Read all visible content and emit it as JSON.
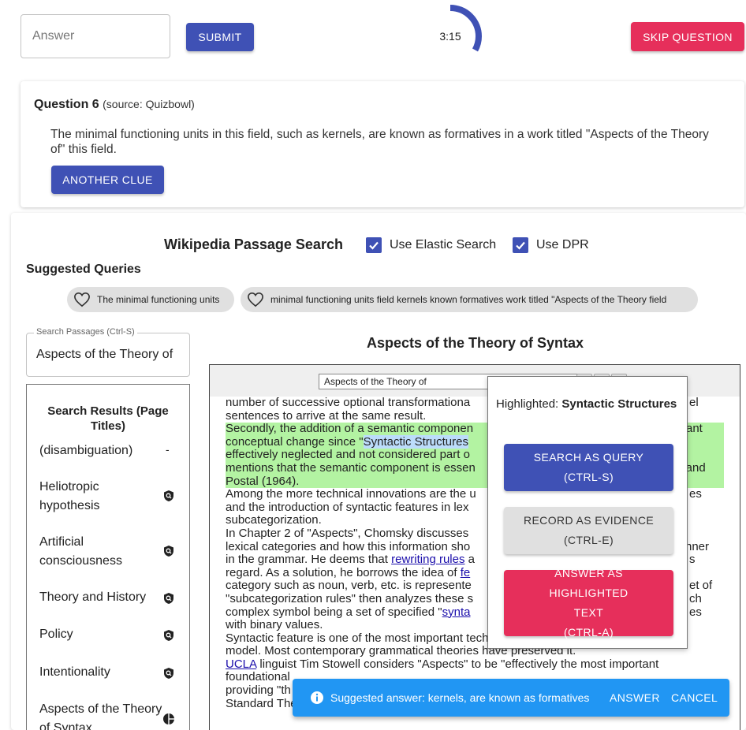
{
  "top_bar": {
    "answer_placeholder": "Answer",
    "submit_label": "SUBMIT",
    "timer_text": "3:15",
    "timer_progress": 0.33,
    "skip_label": "SKIP QUESTION"
  },
  "question": {
    "title": "Question 6",
    "source": "(source: Quizbowl)",
    "text": "The minimal functioning units in this field, such as kernels, are known as formatives in a work titled \"Aspects of the Theory of\" this field.",
    "another_clue_label": "ANOTHER CLUE"
  },
  "wiki_search": {
    "title": "Wikipedia Passage Search",
    "use_elastic_label": "Use Elastic Search",
    "use_elastic_checked": true,
    "use_dpr_label": "Use DPR",
    "use_dpr_checked": true
  },
  "suggested_queries": {
    "title": "Suggested Queries",
    "chips": [
      "The minimal functioning units",
      "minimal functioning units field kernels known formatives work titled \"Aspects of the Theory field"
    ]
  },
  "search_passages": {
    "label": "Search Passages (Ctrl-S)",
    "value": "Aspects of the Theory of"
  },
  "search_results": {
    "title": "Search Results (Page Titles)",
    "items": [
      {
        "label": "(disambiguation)",
        "icon": "dash-icon"
      },
      {
        "label": "Heliotropic hypothesis",
        "icon": "shield-search-icon"
      },
      {
        "label": "Artificial consciousness",
        "icon": "shield-search-icon"
      },
      {
        "label": "Theory and History",
        "icon": "shield-search-icon"
      },
      {
        "label": "Policy",
        "icon": "shield-search-icon"
      },
      {
        "label": "Intentionality",
        "icon": "shield-search-icon"
      },
      {
        "label": "Aspects of the Theory of Syntax",
        "icon": "half-circle-icon"
      }
    ]
  },
  "article": {
    "title": "Aspects of the Theory of Syntax",
    "find_value": "Aspects of the Theory of",
    "highlight_color": "#b3f3a2",
    "selection_color": "#bcdcfb",
    "p0": "number of successive optional transformationa",
    "p0b": "el",
    "p0c": "sentences to arrive at the same result.",
    "p1a": "Secondly, the addition of a semantic componen",
    "p1b": "ant",
    "p1c": "conceptual change since \"",
    "p1sel": "Syntactic Structures",
    "p1d": "effectively neglected and not considered part o",
    "p1e": "mentions that the semantic component is essen",
    "p1f": "z and",
    "p1g": "Postal (1964).",
    "p2a": "Among the more technical innovations are the u",
    "p2b": "es",
    "p2c": "and the introduction of syntactic features in lex",
    "p2d": "subcategorization.",
    "p3a": "In Chapter 2 of \"Aspects\", Chomsky discusses",
    "p3b": "lexical categories and how this information sho",
    "p3c": "nner",
    "p3d": "in the grammar. He deems that ",
    "p3link1": "rewriting rules",
    "p3e": " a",
    "p3f": "s",
    "p3g": "regard. As a solution, he borrows the idea of ",
    "p3link2": "fe",
    "p3h": "category such as noun, verb, etc. is represente",
    "p3i": "et of",
    "p3j": "\"subcategorization rules\" then analyzes these s",
    "p3k": "ch",
    "p3l": "complex symbol being a set of specified \"",
    "p3link3": "synta",
    "p3m": "es",
    "p3n": "with binary values.",
    "p4a": "Syntactic feature is one of the most important technical innovations of the Aspects",
    "p4b": "model. Most contemporary grammatical theories have preserved it.",
    "p5link": "UCLA",
    "p5a": " linguist Tim Stowell considers \"Aspects\" to be \"effectively the most important",
    "p5b": "foundational",
    "p5c": "providing \"th",
    "p5d": "Standard Theory\"."
  },
  "popup": {
    "highlighted_prefix": "Highlighted: ",
    "highlighted_text": "Syntactic Structures",
    "search_label": "SEARCH AS QUERY",
    "search_shortcut": "(CTRL-S)",
    "record_label": "RECORD AS EVIDENCE",
    "record_shortcut": "(CTRL-E)",
    "answer_label": "ANSWER AS HIGHLIGHTED TEXT",
    "answer_shortcut": "(CTRL-A)"
  },
  "snackbar": {
    "icon": "info-icon",
    "message": "Suggested answer: kernels, are known as formatives",
    "answer_label": "ANSWER",
    "cancel_label": "CANCEL"
  }
}
